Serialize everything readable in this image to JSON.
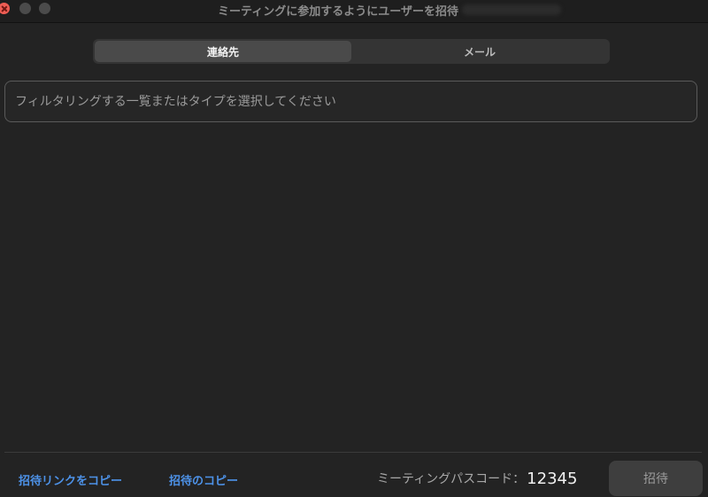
{
  "window": {
    "title": "ミーティングに参加するようにユーザーを招待"
  },
  "tabs": [
    {
      "label": "連絡先",
      "active": true
    },
    {
      "label": "メール",
      "active": false
    }
  ],
  "search": {
    "placeholder": "フィルタリングする一覧またはタイプを選択してください",
    "value": ""
  },
  "footer": {
    "copy_invite_link": "招待リンクをコピー",
    "copy_invitation": "招待のコピー",
    "passcode_label": "ミーティングパスコード：",
    "passcode_value": "12345",
    "invite_button": "招待"
  },
  "colors": {
    "background": "#232323",
    "link": "#4d92e8",
    "close": "#ee5d54"
  }
}
